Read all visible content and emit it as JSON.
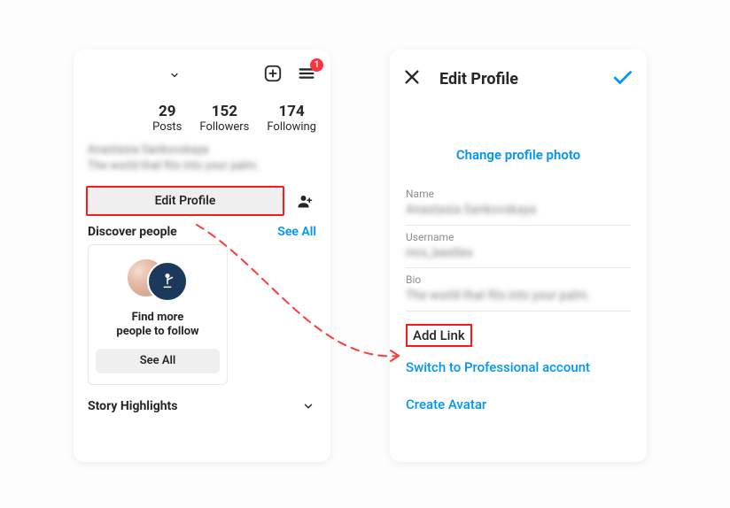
{
  "left": {
    "badge_count": "1",
    "stats": [
      {
        "count": "29",
        "label": "Posts"
      },
      {
        "count": "152",
        "label": "Followers"
      },
      {
        "count": "174",
        "label": "Following"
      }
    ],
    "profile_name_blurred": "Anastasia Sankovskaya",
    "bio_blurred": "The world that fits into your palm.",
    "edit_profile_label": "Edit Profile",
    "discover_title": "Discover people",
    "see_all_link": "See All",
    "find_more_line1": "Find more",
    "find_more_line2": "people to follow",
    "see_all_button": "See All",
    "story_highlights": "Story Highlights"
  },
  "right": {
    "title": "Edit Profile",
    "change_photo": "Change profile photo",
    "fields": {
      "name_label": "Name",
      "name_value_blurred": "Anastasia Sankovskaya",
      "username_label": "Username",
      "username_value_blurred": "mrs_beetles",
      "bio_label": "Bio",
      "bio_value_blurred": "The world that fits into your palm."
    },
    "add_link": "Add Link",
    "switch_professional": "Switch to Professional account",
    "create_avatar": "Create Avatar"
  },
  "colors": {
    "accent": "#0095f6",
    "highlight_red": "#ff1a1a",
    "badge_red": "#ff3040"
  }
}
